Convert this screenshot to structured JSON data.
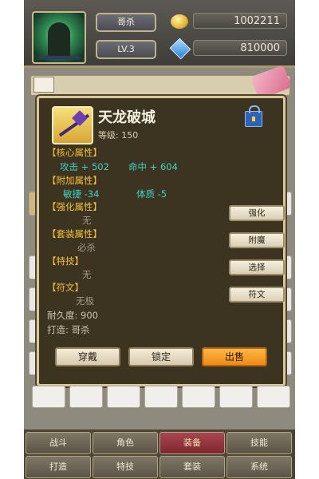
{
  "header": {
    "player_name": "哥杀",
    "level": "LV.3",
    "gold": "1002211",
    "diamonds": "810000"
  },
  "item": {
    "name": "天龙破城",
    "level_text": "等级: 150",
    "core_title": "【核心属性】",
    "core_attack": "攻击 + 502",
    "core_hit": "命中 + 604",
    "extra_title": "【附加属性】",
    "extra_agility": "敏捷 -34",
    "extra_constitution": "体质 -5",
    "enhance_title": "【强化属性】",
    "enhance_value": "无",
    "set_title": "【套装属性】",
    "set_value": "必杀",
    "skill_title": "【特技】",
    "skill_value": "无",
    "rune_title": "【符文】",
    "rune_value": "无极",
    "durability": "耐久度: 900",
    "forged_by": "打造: 哥杀"
  },
  "side_buttons": {
    "enhance": "强化",
    "enchant": "附魔",
    "select": "选择",
    "rune": "符文"
  },
  "actions": {
    "wear": "穿戴",
    "lock": "锁定",
    "sell": "出售"
  },
  "nav": {
    "battle": "战斗",
    "character": "角色",
    "equipment": "装备",
    "skills": "技能",
    "forge": "打造",
    "special": "特技",
    "set": "套装",
    "system": "系统"
  },
  "colors": {
    "section_title": "#f2c13e",
    "stat_value": "#3fd3c4",
    "sell_button": "#ef8a14",
    "active_tab": "#7e2630"
  }
}
